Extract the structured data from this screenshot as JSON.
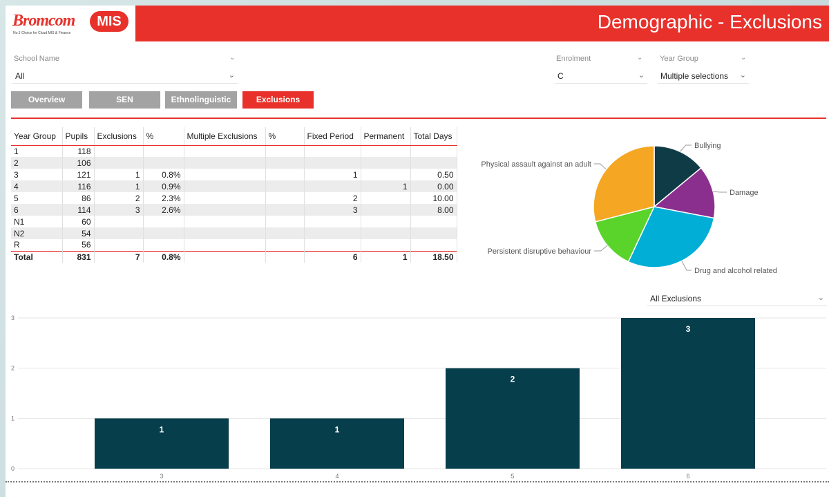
{
  "header": {
    "brand": "Bromcom",
    "brand_badge": "MIS",
    "brand_tagline": "No.1 Choice for Cloud MIS & Finance",
    "title": "Demographic - Exclusions"
  },
  "filters": {
    "school": {
      "label": "School Name",
      "value": "All"
    },
    "enrolment": {
      "label": "Enrolment",
      "value": "C"
    },
    "year_group": {
      "label": "Year Group",
      "value": "Multiple selections"
    },
    "exclusion_type": {
      "value": "All Exclusions"
    }
  },
  "tabs": [
    {
      "label": "Overview",
      "active": false
    },
    {
      "label": "SEN",
      "active": false
    },
    {
      "label": "Ethnolinguistic",
      "active": false
    },
    {
      "label": "Exclusions",
      "active": true
    }
  ],
  "table": {
    "columns": [
      "Year Group",
      "Pupils",
      "Exclusions",
      "%",
      "Multiple Exclusions",
      "%",
      "Fixed Period",
      "Permanent",
      "Total Days"
    ],
    "rows": [
      [
        "1",
        "118",
        "",
        "",
        "",
        "",
        "",
        "",
        ""
      ],
      [
        "2",
        "106",
        "",
        "",
        "",
        "",
        "",
        "",
        ""
      ],
      [
        "3",
        "121",
        "1",
        "0.8%",
        "",
        "",
        "1",
        "",
        "0.50"
      ],
      [
        "4",
        "116",
        "1",
        "0.9%",
        "",
        "",
        "",
        "1",
        "0.00"
      ],
      [
        "5",
        "86",
        "2",
        "2.3%",
        "",
        "",
        "2",
        "",
        "10.00"
      ],
      [
        "6",
        "114",
        "3",
        "2.6%",
        "",
        "",
        "3",
        "",
        "8.00"
      ],
      [
        "N1",
        "60",
        "",
        "",
        "",
        "",
        "",
        "",
        ""
      ],
      [
        "N2",
        "54",
        "",
        "",
        "",
        "",
        "",
        "",
        ""
      ],
      [
        "R",
        "56",
        "",
        "",
        "",
        "",
        "",
        "",
        ""
      ]
    ],
    "total": [
      "Total",
      "831",
      "7",
      "0.8%",
      "",
      "",
      "6",
      "1",
      "18.50"
    ]
  },
  "chart_data": [
    {
      "type": "pie",
      "labels": [
        "Bullying",
        "Damage",
        "Drug and alcohol related",
        "Persistent disruptive behaviour",
        "Physical assault against an adult"
      ],
      "values": [
        14,
        14,
        29,
        14,
        29
      ],
      "colors": [
        "#0f3b47",
        "#8b2f8e",
        "#00aed6",
        "#5ad42b",
        "#f5a623"
      ]
    },
    {
      "type": "bar",
      "categories": [
        "3",
        "4",
        "5",
        "6"
      ],
      "values": [
        1,
        1,
        2,
        3
      ],
      "ylim": [
        0,
        3
      ],
      "yticks": [
        "0",
        "1",
        "2",
        "3"
      ],
      "color": "#073e4b",
      "grid": true
    }
  ],
  "colors": {
    "accent": "#e8312b",
    "tab_inactive": "#a3a3a3"
  }
}
